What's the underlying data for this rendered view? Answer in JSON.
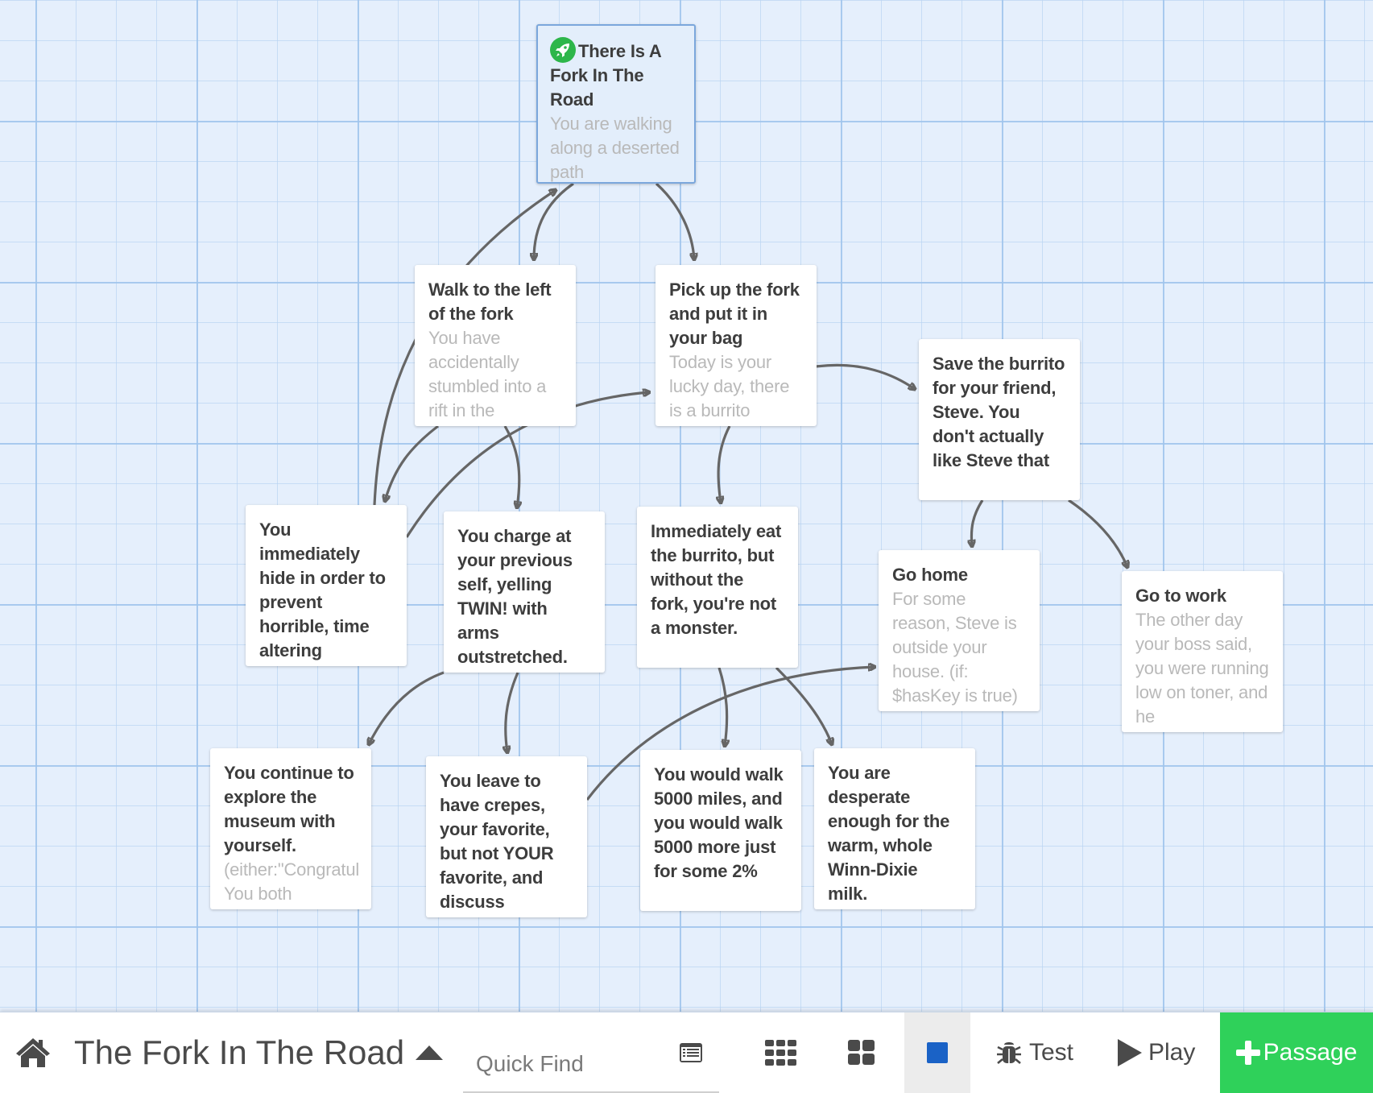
{
  "story": {
    "title": "The Fork In The Road"
  },
  "toolbar": {
    "home_icon": "home-icon",
    "title_caret_icon": "caret-up-icon",
    "quick_find_placeholder": "Quick Find",
    "quick_find_value": "",
    "highlight_icon": "list-icon",
    "zoom_levels": [
      {
        "icon": "grid-9-icon",
        "active": false
      },
      {
        "icon": "grid-4-icon",
        "active": false
      },
      {
        "icon": "square-icon",
        "active": true
      }
    ],
    "test_label": "Test",
    "test_icon": "bug-icon",
    "play_label": "Play",
    "play_icon": "play-icon",
    "passage_label": "Passage",
    "passage_icon": "plus-icon"
  },
  "colors": {
    "canvas_bg": "#e5effc",
    "add_passage_green": "#2fd15a",
    "start_icon_green": "#2db64a",
    "zoom_active_blue": "#1a62c6",
    "link_arrow": "#666666"
  },
  "passages": [
    {
      "id": "start",
      "title": "There Is A Fork In The Road",
      "excerpt": "You are walking along a deserted path",
      "start": true,
      "selected": true
    },
    {
      "id": "walk",
      "title": "Walk to the left of the fork",
      "excerpt": "You have accidentally stumbled into a rift in the",
      "start": false,
      "selected": false
    },
    {
      "id": "pick",
      "title": "Pick up the fork and put it in your bag",
      "excerpt": "Today is your lucky day, there is a burrito",
      "start": false,
      "selected": false
    },
    {
      "id": "save",
      "title": "Save the burrito for your friend, Steve. You don't actually like Steve that",
      "excerpt": "",
      "start": false,
      "selected": false
    },
    {
      "id": "hide",
      "title": "You immediately hide in order to prevent horrible, time altering",
      "excerpt": "",
      "start": false,
      "selected": false
    },
    {
      "id": "charge",
      "title": "You charge at your previous self, yelling TWIN! with arms outstretched.",
      "excerpt": "",
      "start": false,
      "selected": false
    },
    {
      "id": "eat",
      "title": "Immediately eat the burrito, but without the fork, you're not a monster.",
      "excerpt": "",
      "start": false,
      "selected": false
    },
    {
      "id": "home",
      "title": "Go home",
      "excerpt": "For some reason, Steve is outside your house. (if: $hasKey is true)",
      "start": false,
      "selected": false
    },
    {
      "id": "work",
      "title": "Go to work",
      "excerpt": "The other day your boss said, you were running low on toner, and he",
      "start": false,
      "selected": false
    },
    {
      "id": "continue",
      "title": "You continue to explore the museum with yourself.",
      "excerpt": "(either:\"Congratul You both",
      "start": false,
      "selected": false
    },
    {
      "id": "crepes",
      "title": "You leave to have crepes, your favorite, but not YOUR favorite, and discuss",
      "excerpt": "",
      "start": false,
      "selected": false
    },
    {
      "id": "walk5000",
      "title": "You would walk 5000 miles, and you would walk 5000 more just for some 2%",
      "excerpt": "",
      "start": false,
      "selected": false
    },
    {
      "id": "milk",
      "title": "You are desperate enough for the warm, whole Winn-Dixie milk.",
      "excerpt": "",
      "start": false,
      "selected": false
    }
  ],
  "links": [
    {
      "from": "start",
      "to": "walk"
    },
    {
      "from": "start",
      "to": "pick"
    },
    {
      "from": "hide",
      "to": "start"
    },
    {
      "from": "walk",
      "to": "hide"
    },
    {
      "from": "walk",
      "to": "charge"
    },
    {
      "from": "hide",
      "to": "pick"
    },
    {
      "from": "pick",
      "to": "save"
    },
    {
      "from": "pick",
      "to": "eat"
    },
    {
      "from": "save",
      "to": "home"
    },
    {
      "from": "save",
      "to": "work"
    },
    {
      "from": "charge",
      "to": "continue"
    },
    {
      "from": "charge",
      "to": "crepes"
    },
    {
      "from": "eat",
      "to": "walk5000"
    },
    {
      "from": "eat",
      "to": "milk"
    },
    {
      "from": "crepes",
      "to": "home"
    }
  ]
}
